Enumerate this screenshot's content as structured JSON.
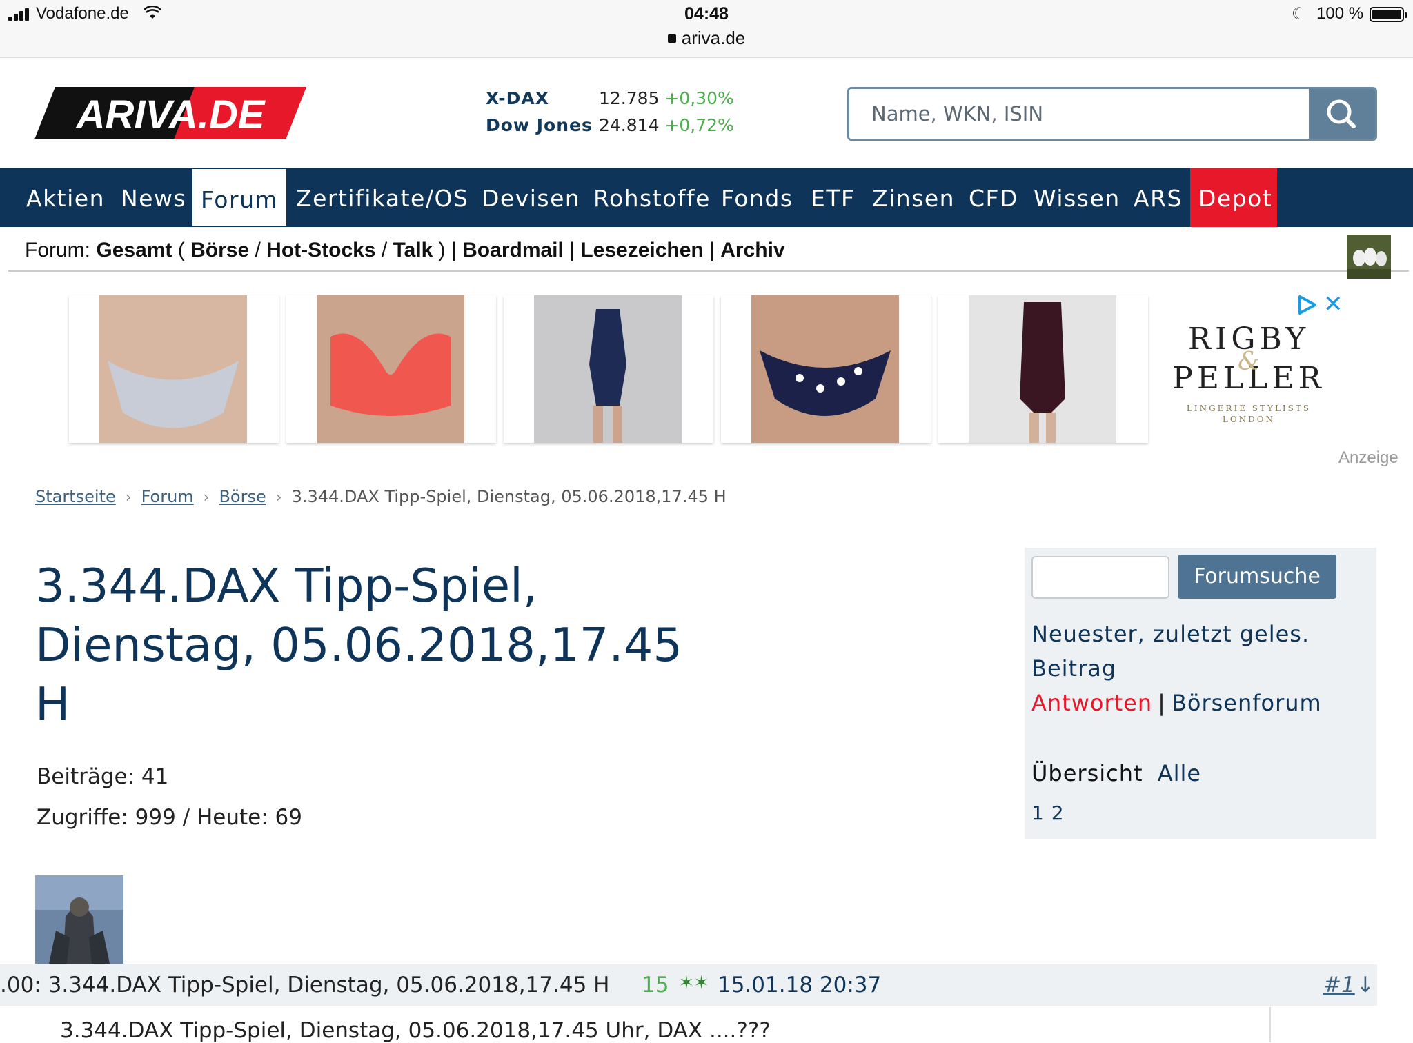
{
  "status_bar": {
    "carrier": "Vodafone.de",
    "time": "04:48",
    "url": "ariva.de",
    "battery": "100 %"
  },
  "header": {
    "logo_text": "ARIVA.DE",
    "tickers": [
      {
        "name": "X-DAX",
        "value": "12.785",
        "change": "+0,30%"
      },
      {
        "name": "Dow Jones",
        "value": "24.814",
        "change": "+0,72%"
      }
    ],
    "search_placeholder": "Name, WKN, ISIN",
    "colors": {
      "navy": "#0e3559",
      "red": "#e8182b",
      "green": "#4cae4c"
    }
  },
  "nav": {
    "items": [
      "Aktien",
      "News",
      "Forum",
      "Zertifikate/OS",
      "Devisen",
      "Rohstoffe",
      "Fonds",
      "ETF",
      "Zinsen",
      "CFD",
      "Wissen",
      "ARS",
      "Depot"
    ],
    "active": "Forum"
  },
  "forum_bar": {
    "prefix": "Forum:",
    "gesamt": "Gesamt",
    "borse": "Börse",
    "hot_stocks": "Hot-Stocks",
    "talk": "Talk",
    "boardmail": "Boardmail",
    "lesezeichen": "Lesezeichen",
    "archiv": "Archiv"
  },
  "ad": {
    "brand_line1": "RIGBY",
    "brand_amp": "&",
    "brand_line2": "PELLER",
    "tagline": "LINGERIE STYLISTS",
    "tagline2": "LONDON",
    "label": "Anzeige"
  },
  "breadcrumb": [
    "Startseite",
    "Forum",
    "Börse",
    "3.344.DAX Tipp-Spiel, Dienstag, 05.06.2018,17.45 H"
  ],
  "thread": {
    "title": "3.344.DAX Tipp-Spiel, Dienstag, 05.06.2018,17.45 H",
    "posts_stat": "Beiträge: 41",
    "views_stat": "Zugriffe: 999 / Heute: 69"
  },
  "sidebar": {
    "search_button": "Forumsuche",
    "link_newest": "Neuester, zuletzt geles.",
    "link_beitrag": "Beitrag",
    "link_antworten": "Antworten",
    "link_borsenforum": "Börsenforum",
    "overview": "Übersicht",
    "overview_all": "Alle",
    "pages": [
      "1",
      "2"
    ]
  },
  "post": {
    "subject": ".00: 3.344.DAX Tipp-Spiel, Dienstag, 05.06.2018,17.45 H",
    "star_count": "15",
    "date": "15.01.18 20:37",
    "number": "#1",
    "arrow": "↓",
    "body": "3.344.DAX Tipp-Spiel, Dienstag, 05.06.2018,17.45 Uhr, DAX ....???"
  }
}
